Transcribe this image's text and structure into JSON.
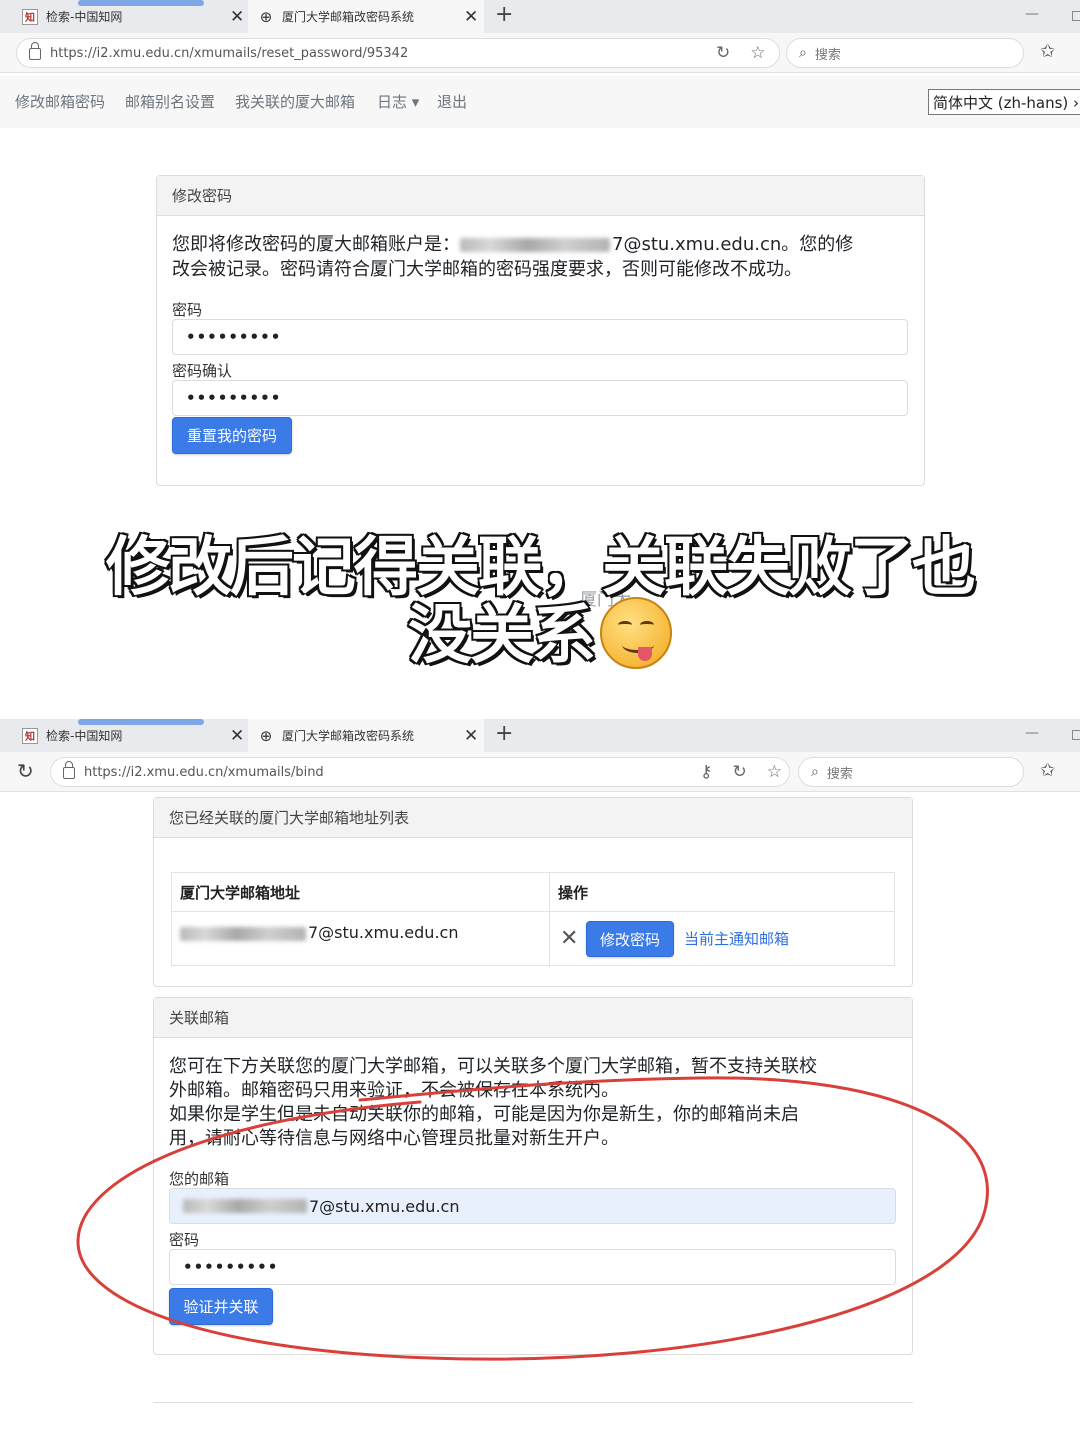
{
  "browser_top": {
    "tab1_title": "检索-中国知网",
    "tab2_title": "厦门大学邮箱改密码系统",
    "url": "https://i2.xmu.edu.cn/xmumails/reset_password/95342",
    "search_placeholder": "搜索"
  },
  "app_nav": {
    "items": [
      "修改邮箱密码",
      "邮箱别名设置",
      "我关联的厦大邮箱",
      "日志 ▾",
      "退出"
    ],
    "language": "简体中文 (zh-hans) ›"
  },
  "reset_card": {
    "header": "修改密码",
    "text_line1_prefix": "您即将修改密码的厦大邮箱账户是：",
    "text_line1_suffix": "7@stu.xmu.edu.cn。您的修",
    "text_line2": "改会被记录。密码请符合厦门大学邮箱的密码强度要求，否则可能修改不成功。",
    "password_label": "密码",
    "password_value": "•••••••••",
    "confirm_label": "密码确认",
    "confirm_value": "•••••••••",
    "submit_label": "重置我的密码"
  },
  "overlay": {
    "caption_line1": "修改后记得关联，关联失败了也",
    "caption_line2": "没关系",
    "emoji": "savoring-face-emoji",
    "ghost_text": "厦门大"
  },
  "browser_bottom": {
    "tab1_title": "检索-中国知网",
    "tab2_title": "厦门大学邮箱改密码系统",
    "url": "https://i2.xmu.edu.cn/xmumails/bind",
    "search_placeholder": "搜索"
  },
  "linked_card": {
    "header": "您已经关联的厦门大学邮箱地址列表",
    "col_address": "厦门大学邮箱地址",
    "col_action": "操作",
    "row_email_suffix": "7@stu.xmu.edu.cn",
    "change_password_btn": "修改密码",
    "primary_notice": "当前主通知邮箱"
  },
  "bind_card": {
    "header": "关联邮箱",
    "line1": "您可在下方关联您的厦门大学邮箱，可以关联多个厦门大学邮箱，暂不支持关联校",
    "line2": "外邮箱。邮箱密码只用来验证，不会被保存在本系统内。",
    "line3": "如果你是学生但是未自动关联你的邮箱，可能是因为你是新生，你的邮箱尚未启",
    "line4": "用，请耐心等待信息与网络中心管理员批量对新生开户。",
    "email_label": "您的邮箱",
    "email_suffix": "7@stu.xmu.edu.cn",
    "password_label": "密码",
    "password_value": "•••••••••",
    "submit_label": "验证并关联"
  },
  "colors": {
    "primary_button": "#3b7be8",
    "link": "#2f6fe0",
    "annotation_circle": "#d8403a",
    "autofill_bg": "#e8f0fe"
  }
}
